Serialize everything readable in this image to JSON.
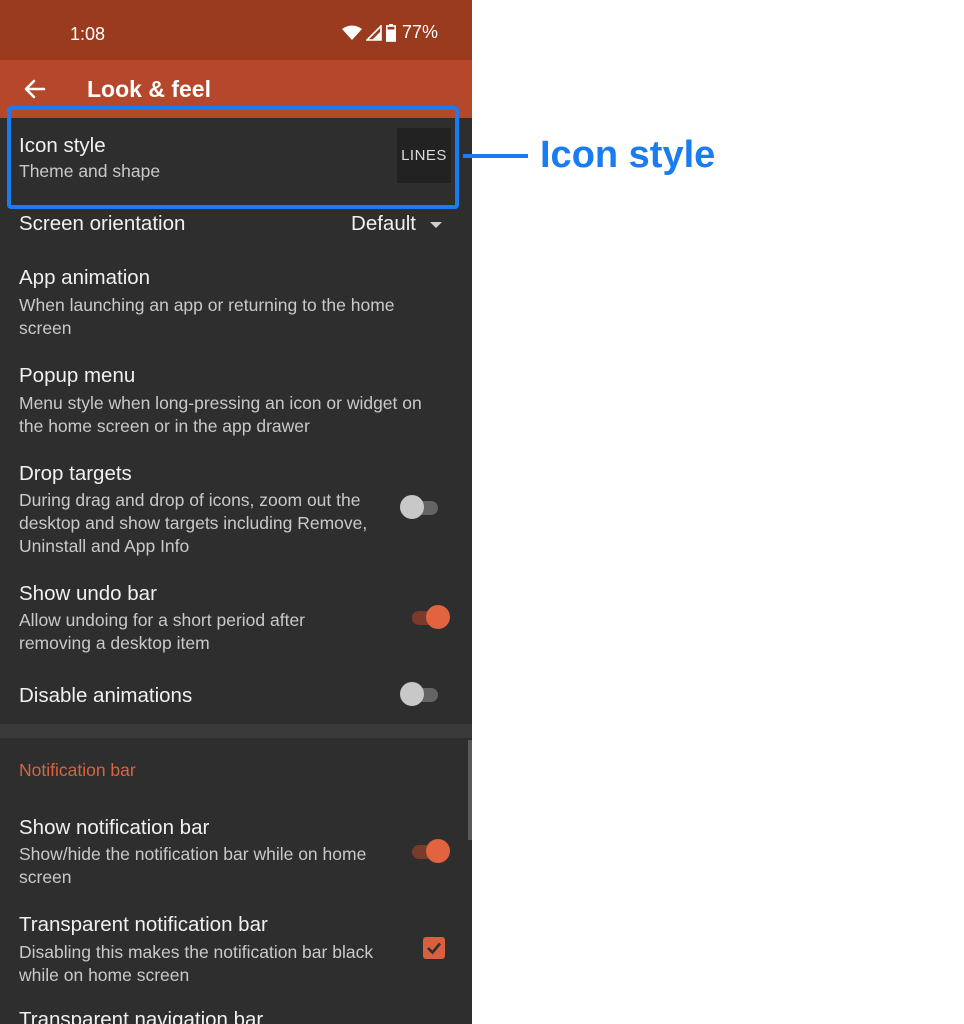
{
  "status_bar": {
    "time": "1:08",
    "battery": "77%",
    "icons": [
      "wifi-icon",
      "signal-icon",
      "battery-icon"
    ]
  },
  "app_bar": {
    "title": "Look & feel",
    "back_icon": "arrow-back-icon"
  },
  "settings": {
    "icon_style": {
      "title": "Icon style",
      "subtitle": "Theme and shape",
      "value": "LINES"
    },
    "screen_orientation": {
      "title": "Screen orientation",
      "value": "Default"
    },
    "app_animation": {
      "title": "App animation",
      "subtitle": "When launching an app or returning to the home screen"
    },
    "popup_menu": {
      "title": "Popup menu",
      "subtitle": "Menu style when long-pressing an icon or widget on the home screen or in the app drawer"
    },
    "drop_targets": {
      "title": "Drop targets",
      "subtitle": "During drag and drop of icons, zoom out the desktop and show targets including Remove, Uninstall and App Info",
      "enabled": false
    },
    "show_undo_bar": {
      "title": "Show undo bar",
      "subtitle": "Allow undoing for a short period after removing a desktop item",
      "enabled": true
    },
    "disable_animations": {
      "title": "Disable animations",
      "enabled": false
    }
  },
  "notification_section": {
    "header": "Notification bar",
    "show_notification_bar": {
      "title": "Show notification bar",
      "subtitle": "Show/hide the notification bar while on home screen",
      "enabled": true
    },
    "transparent_notification_bar": {
      "title": "Transparent notification bar",
      "subtitle": "Disabling this makes the notification bar black while on home screen",
      "checked": true
    },
    "transparent_navigation_bar": {
      "title": "Transparent navigation bar"
    }
  },
  "annotation": {
    "label": "Icon style"
  },
  "colors": {
    "status_bar": "#9a3a1e",
    "app_bar": "#b5472b",
    "background": "#2e2e2e",
    "accent": "#e2633f",
    "annotation": "#1a7cf0"
  }
}
